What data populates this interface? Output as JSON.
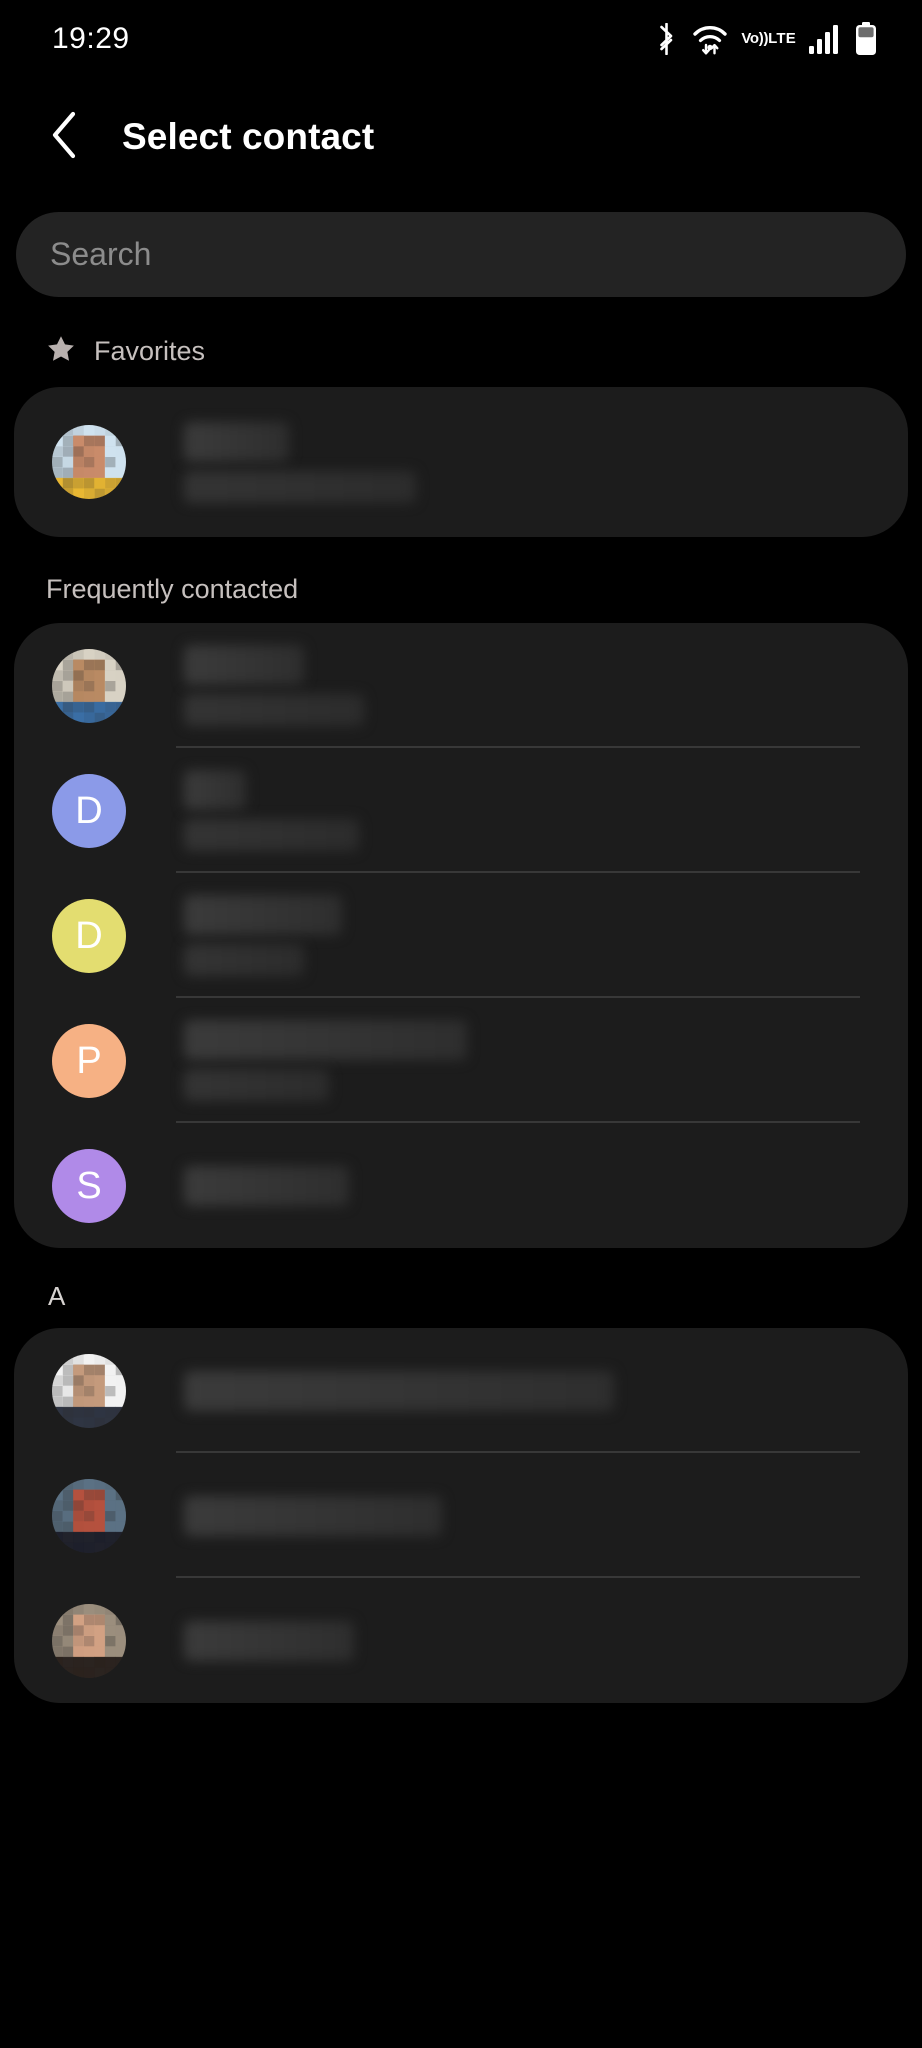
{
  "status_bar": {
    "time": "19:29",
    "icons": [
      "bluetooth-icon",
      "wifi-icon",
      "volte-icon",
      "signal-icon",
      "battery-icon"
    ],
    "volte_line1": "Vo))",
    "volte_line2": "LTE"
  },
  "header": {
    "back_icon": "chevron-left-icon",
    "title": "Select contact"
  },
  "search": {
    "placeholder": "Search",
    "value": ""
  },
  "sections": [
    {
      "id": "favorites",
      "label": "Favorites",
      "icon": "star-icon",
      "has_icon": true,
      "contacts": [
        {
          "avatar_type": "photo",
          "avatar_colors": [
            "#cfe2ef",
            "#e8b733",
            "#c98b6a"
          ],
          "name": "",
          "name_redacted": true,
          "name_width": 105,
          "subtitle": "",
          "subtitle_redacted": true,
          "subtitle_width": 232
        }
      ]
    },
    {
      "id": "frequently-contacted",
      "label": "Frequently contacted",
      "icon": "",
      "has_icon": false,
      "contacts": [
        {
          "avatar_type": "photo",
          "avatar_colors": [
            "#d8d2c4",
            "#3a6ea5",
            "#b98a63"
          ],
          "name": "",
          "name_redacted": true,
          "name_width": 120,
          "subtitle": "",
          "subtitle_redacted": true,
          "subtitle_width": 180
        },
        {
          "avatar_type": "letter",
          "letter": "D",
          "color": "#8b9ae8",
          "name": "",
          "name_redacted": true,
          "name_width": 62,
          "subtitle": "",
          "subtitle_redacted": true,
          "subtitle_width": 175
        },
        {
          "avatar_type": "letter",
          "letter": "D",
          "color": "#e3dd70",
          "name": "",
          "name_redacted": true,
          "name_width": 158,
          "subtitle": "",
          "subtitle_redacted": true,
          "subtitle_width": 120
        },
        {
          "avatar_type": "letter",
          "letter": "P",
          "color": "#f6b184",
          "name": "",
          "name_redacted": true,
          "name_width": 283,
          "subtitle": "",
          "subtitle_redacted": true,
          "subtitle_width": 145
        },
        {
          "avatar_type": "letter",
          "letter": "S",
          "color": "#b08ae8",
          "name": "",
          "name_redacted": true,
          "name_width": 165,
          "subtitle": "",
          "subtitle_redacted": true,
          "subtitle_width": 0
        }
      ]
    },
    {
      "id": "alpha-a",
      "label": "A",
      "icon": "",
      "has_icon": false,
      "contacts": [
        {
          "avatar_type": "photo",
          "avatar_colors": [
            "#f2f2f2",
            "#2f3543",
            "#c49a7c"
          ],
          "name": "",
          "name_redacted": true,
          "name_width": 430,
          "subtitle": "",
          "subtitle_redacted": true,
          "subtitle_width": 0
        },
        {
          "avatar_type": "photo",
          "avatar_colors": [
            "#5b7184",
            "#1d1f2b",
            "#b5513e"
          ],
          "name": "",
          "name_redacted": true,
          "name_width": 258,
          "subtitle": "",
          "subtitle_redacted": true,
          "subtitle_width": 0
        },
        {
          "avatar_type": "photo",
          "avatar_colors": [
            "#9b8e7d",
            "#2b221d",
            "#d2a183"
          ],
          "name": "",
          "name_redacted": true,
          "name_width": 170,
          "subtitle": "",
          "subtitle_redacted": true,
          "subtitle_width": 0
        }
      ]
    }
  ],
  "colors": {
    "background": "#000000",
    "card": "#1c1c1c",
    "search_field": "#232323",
    "divider": "#383838",
    "title_text": "#ffffff",
    "section_text": "#c6c0be",
    "placeholder_text": "#8c8c8c"
  }
}
